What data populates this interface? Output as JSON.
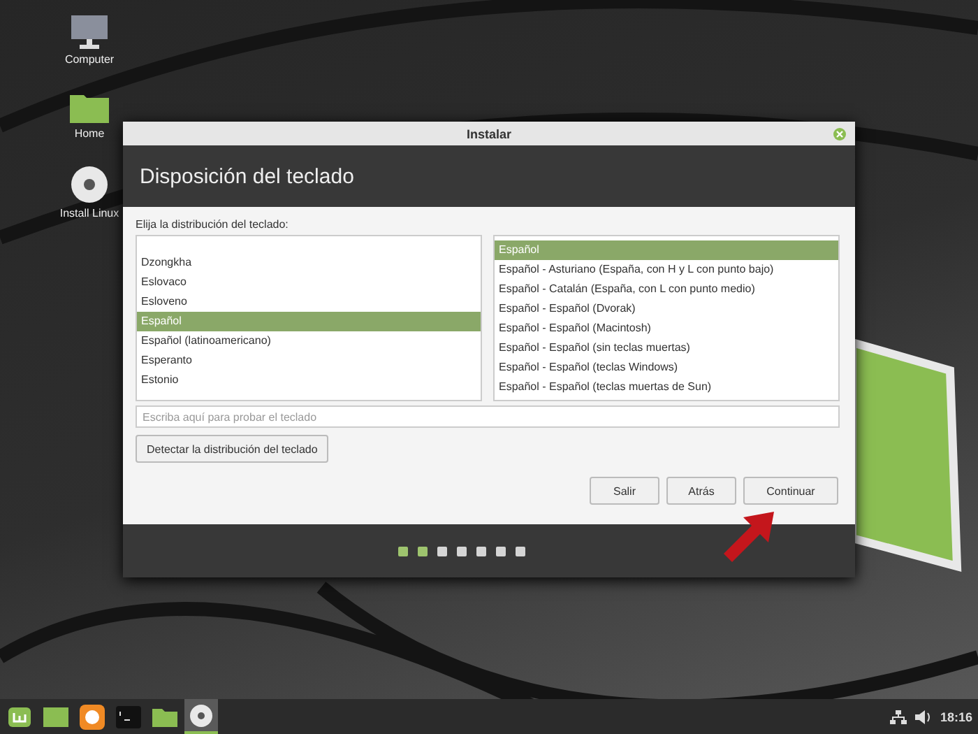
{
  "desktop_icons": [
    {
      "label": "Computer",
      "kind": "computer"
    },
    {
      "label": "Home",
      "kind": "folder"
    },
    {
      "label": "Install Linux",
      "kind": "disc"
    }
  ],
  "window": {
    "title": "Instalar",
    "heading": "Disposición del teclado",
    "prompt": "Elija la distribución del teclado:",
    "layouts": [
      {
        "label": "Dzongkha",
        "selected": false
      },
      {
        "label": "Eslovaco",
        "selected": false
      },
      {
        "label": "Esloveno",
        "selected": false
      },
      {
        "label": "Español",
        "selected": true
      },
      {
        "label": "Español (latinoamericano)",
        "selected": false
      },
      {
        "label": "Esperanto",
        "selected": false
      },
      {
        "label": "Estonio",
        "selected": false
      }
    ],
    "variants": [
      {
        "label": "Español",
        "selected": true
      },
      {
        "label": "Español - Asturiano (España, con H y L con punto bajo)",
        "selected": false
      },
      {
        "label": "Español - Catalán (España, con L con punto medio)",
        "selected": false
      },
      {
        "label": "Español - Español (Dvorak)",
        "selected": false
      },
      {
        "label": "Español - Español (Macintosh)",
        "selected": false
      },
      {
        "label": "Español - Español (sin teclas muertas)",
        "selected": false
      },
      {
        "label": "Español - Español (teclas Windows)",
        "selected": false
      },
      {
        "label": "Español - Español (teclas muertas de Sun)",
        "selected": false
      }
    ],
    "test_field": {
      "placeholder": "Escriba aquí para probar el teclado"
    },
    "detect_button": "Detectar la distribución del teclado",
    "buttons": [
      "Salir",
      "Atrás",
      "Continuar"
    ],
    "steps": [
      {
        "done": true
      },
      {
        "done": true
      },
      {
        "done": false
      },
      {
        "done": false
      },
      {
        "done": false
      },
      {
        "done": false
      },
      {
        "done": false
      }
    ]
  },
  "taskbar": {
    "apps": [
      {
        "kind": "menu",
        "active": false
      },
      {
        "kind": "files",
        "active": false
      },
      {
        "kind": "browser",
        "active": false
      },
      {
        "kind": "terminal",
        "active": false
      },
      {
        "kind": "folder",
        "active": false
      },
      {
        "kind": "disc",
        "active": true
      }
    ],
    "clock": "18:16"
  }
}
